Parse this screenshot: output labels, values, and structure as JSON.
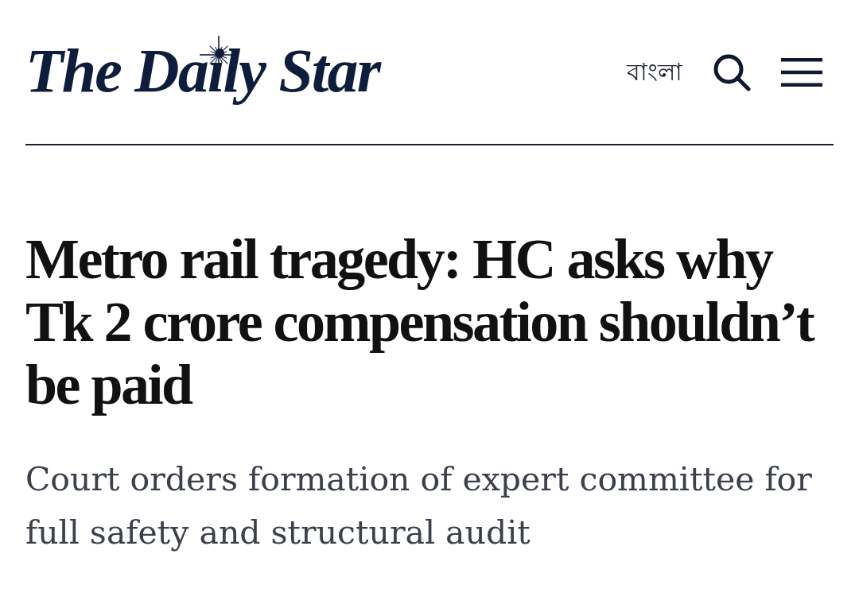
{
  "header": {
    "logo": "The Daily Star",
    "language_link": "বাংলা"
  },
  "article": {
    "headline": "Metro rail tragedy: HC asks why Tk 2 crore compensation shouldn’t be paid",
    "subheadline": "Court orders formation of expert committee for full safety and structural audit"
  }
}
